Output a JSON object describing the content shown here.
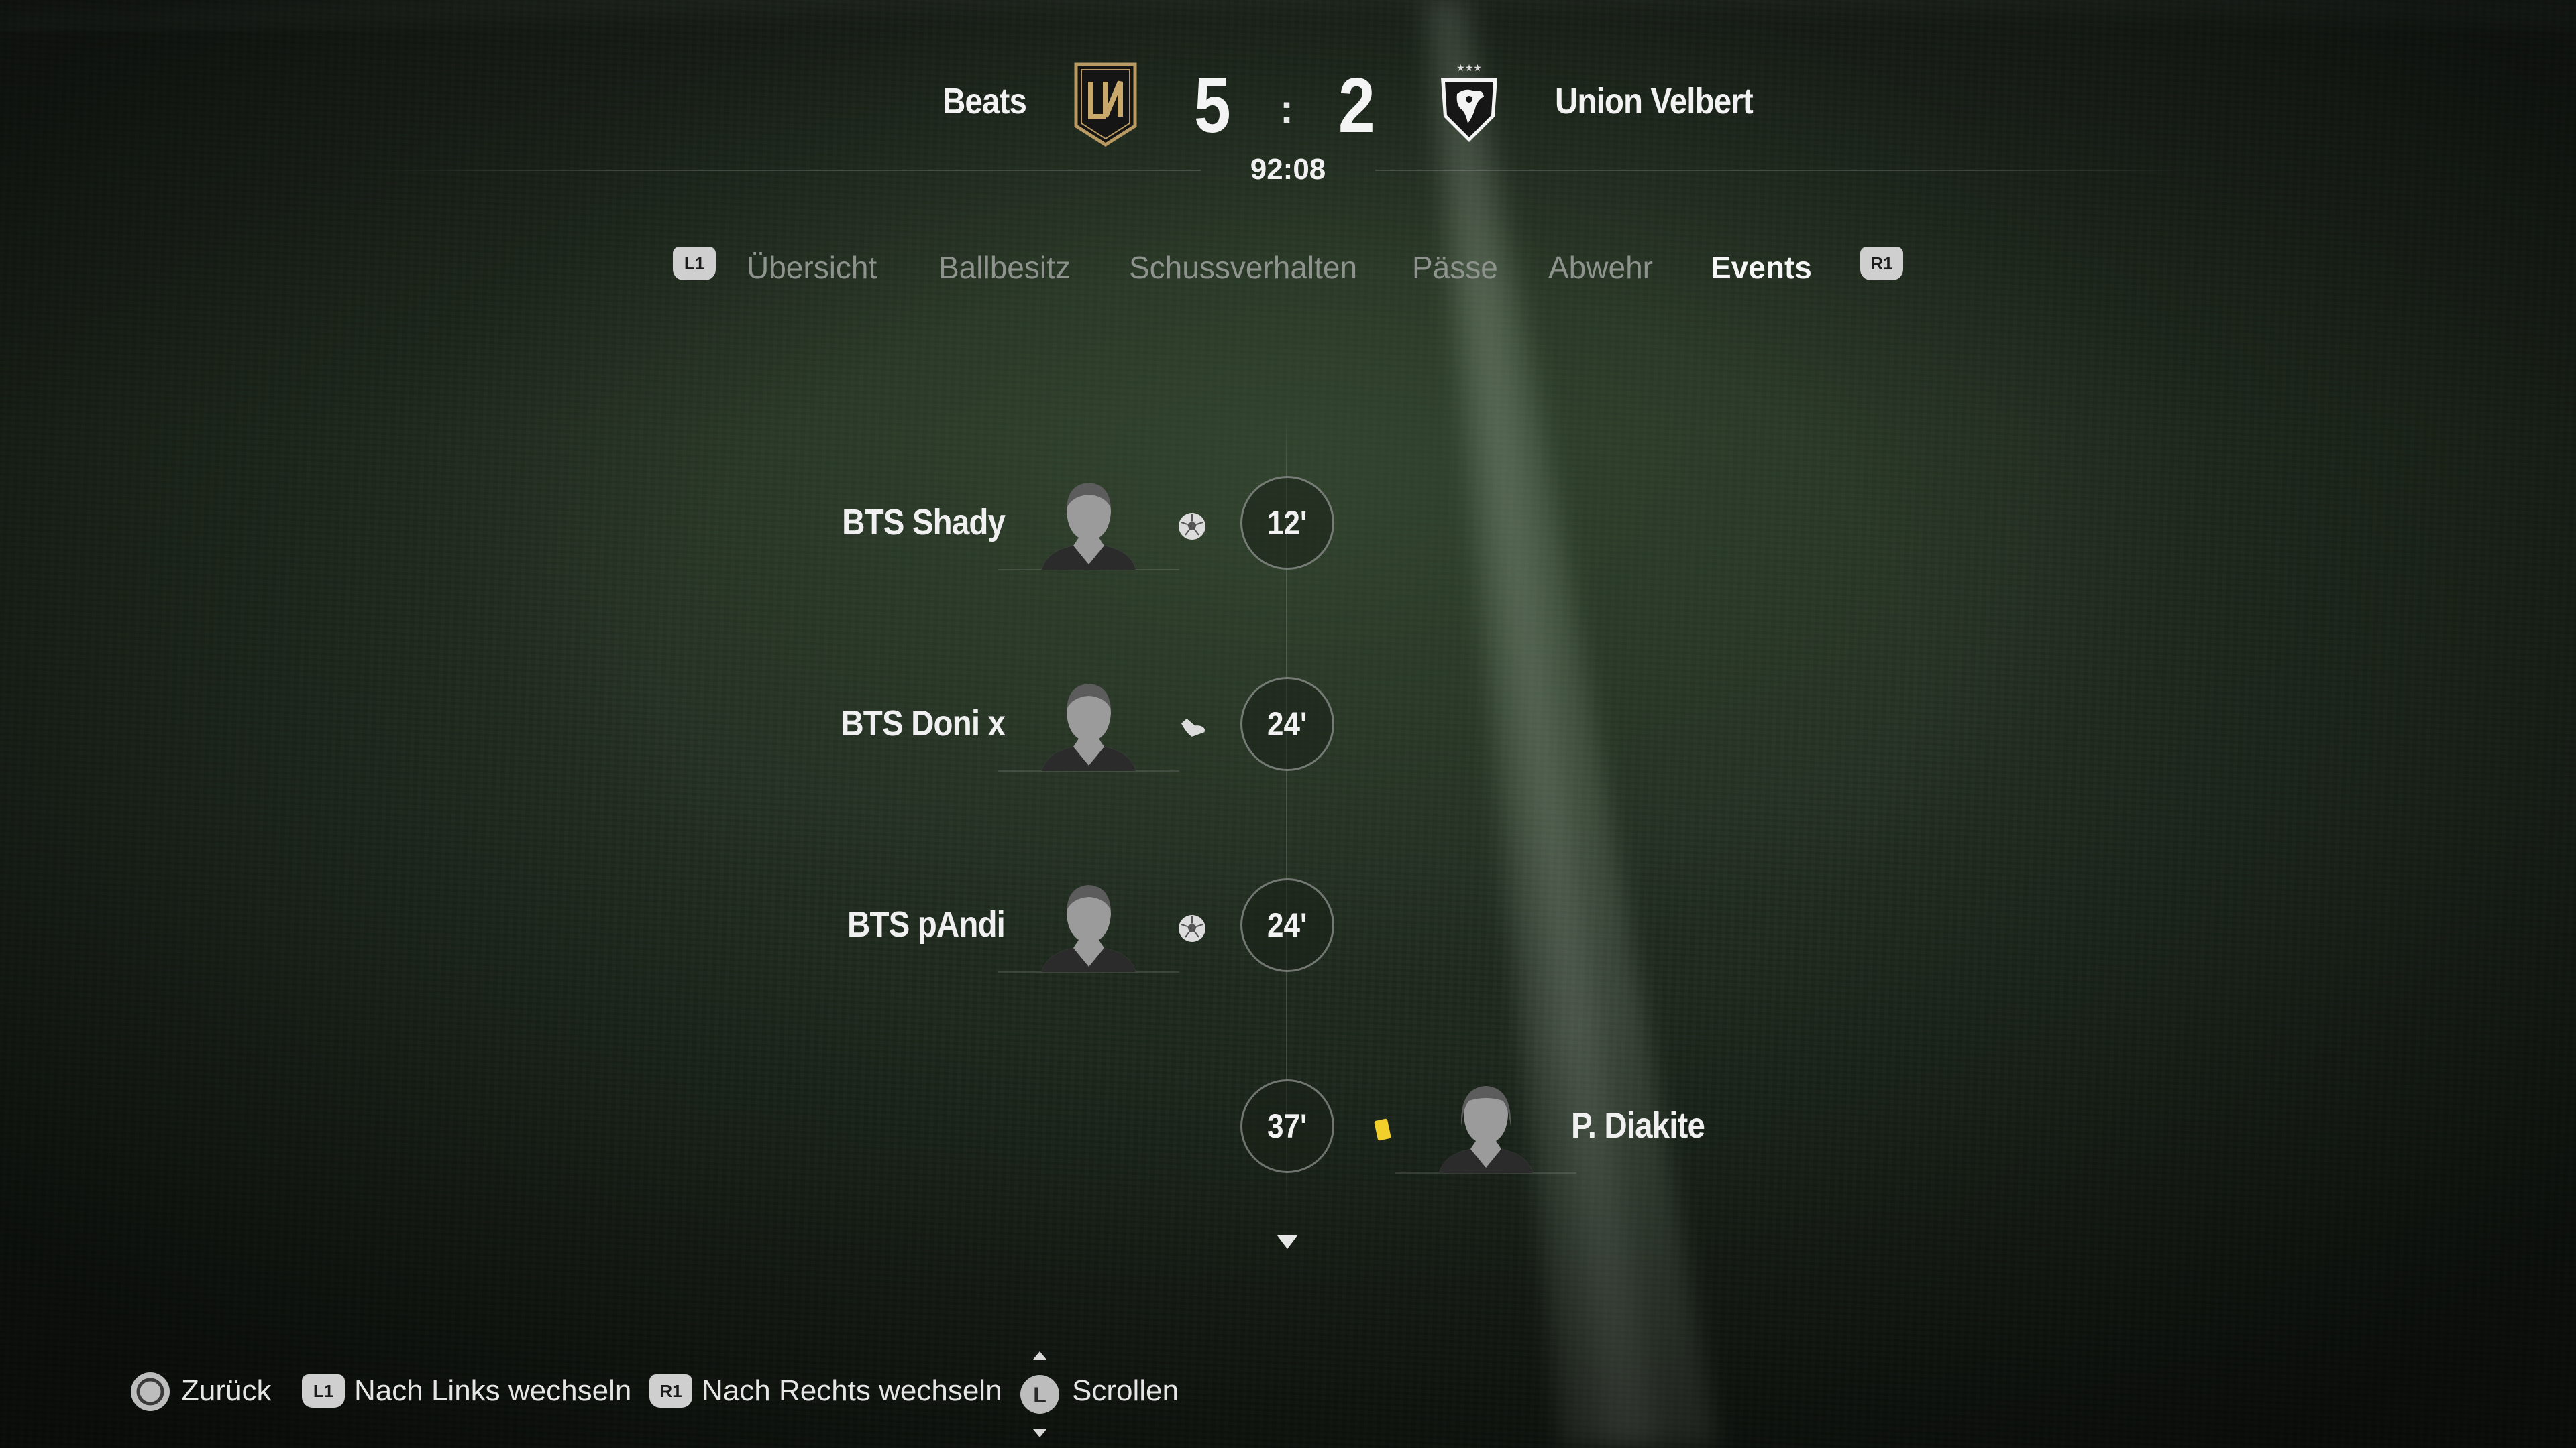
{
  "match": {
    "home_team": "Beats",
    "away_team": "Union Velbert",
    "home_score": "5",
    "away_score": "2",
    "separator": ":",
    "clock": "92:08"
  },
  "tabs": {
    "left_button": "L1",
    "right_button": "R1",
    "items": [
      "Übersicht",
      "Ballbesitz",
      "Schussverhalten",
      "Pässe",
      "Abwehr",
      "Events"
    ],
    "active": "Events"
  },
  "events": [
    {
      "minute": "12'",
      "player": "BTS Shady",
      "team": "home",
      "type": "goal-icon"
    },
    {
      "minute": "24'",
      "player": "BTS Doni x",
      "team": "home",
      "type": "assist-boot-icon"
    },
    {
      "minute": "24'",
      "player": "BTS pAndi",
      "team": "home",
      "type": "goal-icon"
    },
    {
      "minute": "37'",
      "player": "P. Diakite",
      "team": "away",
      "type": "yellow-card-icon"
    }
  ],
  "colors": {
    "yellow_card": "#f2cf2a",
    "active_tab": "#f6f6f6",
    "inactive_tab": "#8e948d"
  },
  "footer": {
    "back": {
      "button": "circle-button-icon",
      "label": "Zurück"
    },
    "prev": {
      "button": "L1",
      "label": "Nach Links wechseln"
    },
    "next": {
      "button": "R1",
      "label": "Nach Rechts wechseln"
    },
    "scroll": {
      "button": "L",
      "label": "Scrollen"
    }
  }
}
